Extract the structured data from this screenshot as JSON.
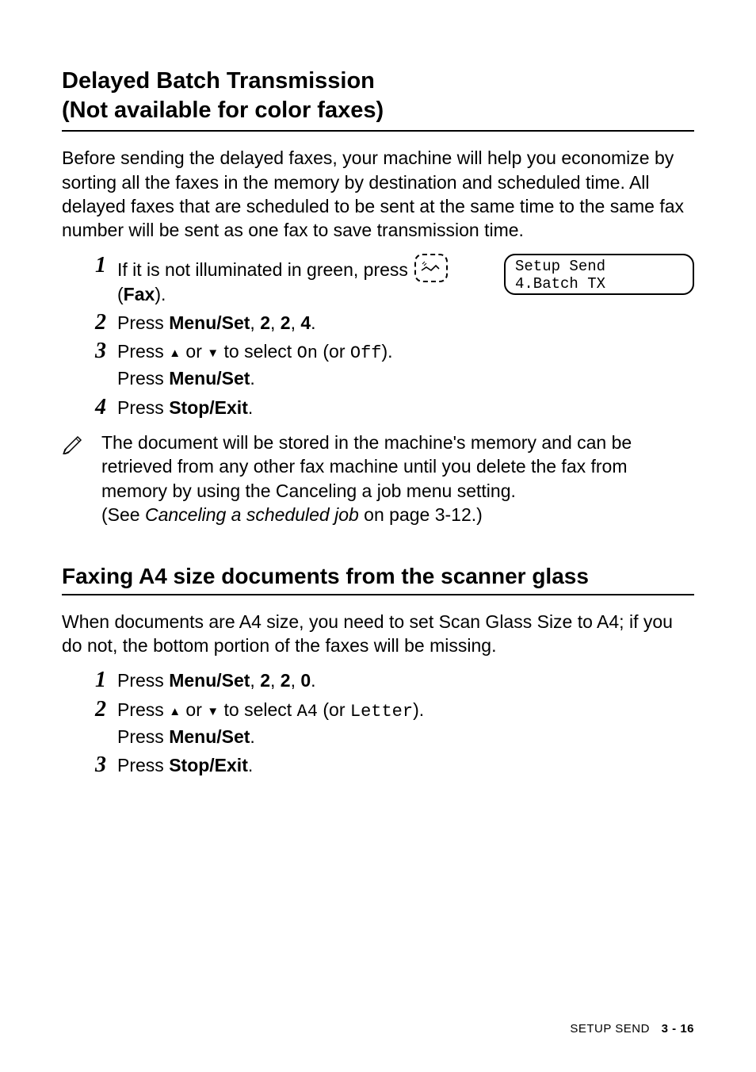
{
  "section1": {
    "heading_line1": "Delayed Batch Transmission",
    "heading_line2": "(Not available for color faxes)",
    "intro": "Before sending the delayed faxes, your machine will help you economize by sorting all the faxes in the memory by destination and scheduled time. All delayed faxes that are scheduled to be sent at the same time to the same fax number will be sent as one fax to save transmission time.",
    "steps": {
      "s1": {
        "num": "1",
        "a": "If it is not illuminated in green, press ",
        "b": " (",
        "fax": "Fax",
        "c": ")."
      },
      "s2": {
        "num": "2",
        "a": "Press ",
        "menu": "Menu/Set",
        "b": ", ",
        "n1": "2",
        "n2": "2",
        "n3": "4",
        "c": "."
      },
      "s3": {
        "num": "3",
        "a": "Press ",
        "b": " or ",
        "c": " to select ",
        "on": "On",
        "d": " (or ",
        "off": "Off",
        "e": ").",
        "f": "Press ",
        "menu": "Menu/Set",
        "g": "."
      },
      "s4": {
        "num": "4",
        "a": "Press ",
        "stop": "Stop/Exit",
        "b": "."
      }
    },
    "lcd": {
      "line1": "Setup Send",
      "line2": "4.Batch TX"
    },
    "note": {
      "a": "The document will be stored in the machine's memory and can be retrieved from any other fax machine until you delete the fax from memory by using the Canceling a job menu setting.",
      "b": "(See ",
      "ref": "Canceling a scheduled job",
      "c": " on page 3-12.)"
    }
  },
  "section2": {
    "heading": "Faxing A4 size documents from the scanner glass",
    "intro": "When documents are A4 size, you need to set Scan Glass Size to A4; if you do not, the bottom portion of the faxes will be missing.",
    "steps": {
      "s1": {
        "num": "1",
        "a": "Press ",
        "menu": "Menu/Set",
        "b": ", ",
        "n1": "2",
        "n2": "2",
        "n3": "0",
        "c": "."
      },
      "s2": {
        "num": "2",
        "a": "Press ",
        "b": " or ",
        "c": " to select ",
        "a4": "A4",
        "d": " (or ",
        "letter": "Letter",
        "e": ").",
        "f": "Press ",
        "menu": "Menu/Set",
        "g": "."
      },
      "s3": {
        "num": "3",
        "a": "Press ",
        "stop": "Stop/Exit",
        "b": "."
      }
    }
  },
  "footer": {
    "section": "SETUP SEND",
    "page": "3 - 16"
  }
}
